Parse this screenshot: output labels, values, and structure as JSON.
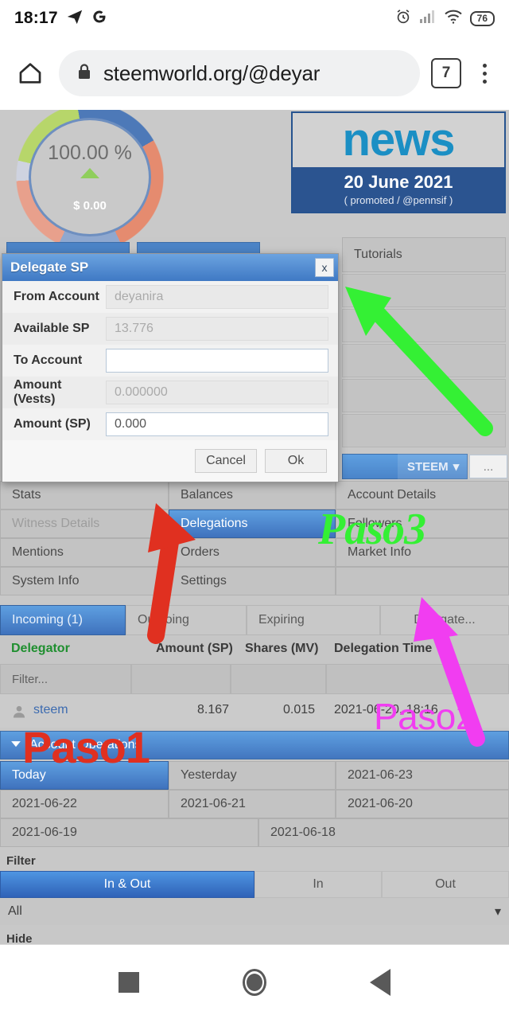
{
  "status_bar": {
    "time": "18:17",
    "icons": [
      "telegram-icon",
      "google-icon",
      "alarm-icon",
      "signal-icon",
      "wifi-icon"
    ],
    "battery": "76"
  },
  "browser": {
    "home_icon": "home-icon",
    "lock_icon": "lock-icon",
    "url": "steemworld.org/@deyar",
    "tab_count": "7",
    "menu_icon": "kebab-menu-icon"
  },
  "hero": {
    "gauge_percent": "100.00 %",
    "gauge_amount": "$ 0.00",
    "news_word": "news",
    "news_date": "20 June 2021",
    "news_sub": "( promoted / @pennsif )",
    "tutorials_label": "Tutorials"
  },
  "dialog": {
    "title": "Delegate SP",
    "close_label": "x",
    "fields": [
      {
        "label": "From Account",
        "value": "deyanira",
        "editable": false
      },
      {
        "label": "Available SP",
        "value": "13.776",
        "editable": false
      },
      {
        "label": "To Account",
        "value": "",
        "editable": true
      },
      {
        "label": "Amount (Vests)",
        "value": "0.000000",
        "editable": false
      },
      {
        "label": "Amount (SP)",
        "value": "0.000",
        "editable": true
      }
    ],
    "cancel_label": "Cancel",
    "ok_label": "Ok"
  },
  "steem_bar": {
    "currency": "STEEM",
    "caret": "▾",
    "more_label": "..."
  },
  "menu_grid": {
    "rows": [
      [
        {
          "label": "Stats",
          "state": "normal"
        },
        {
          "label": "Balances",
          "state": "normal"
        },
        {
          "label": "Account Details",
          "state": "normal"
        }
      ],
      [
        {
          "label": "Witness Details",
          "state": "disabled"
        },
        {
          "label": "Delegations",
          "state": "selected"
        },
        {
          "label": "Followers",
          "state": "normal"
        }
      ],
      [
        {
          "label": "Mentions",
          "state": "normal"
        },
        {
          "label": "Orders",
          "state": "normal"
        },
        {
          "label": "Market Info",
          "state": "normal"
        }
      ],
      [
        {
          "label": "System Info",
          "state": "normal"
        },
        {
          "label": "Settings",
          "state": "normal"
        },
        {
          "label": "",
          "state": "empty"
        }
      ]
    ]
  },
  "delegations": {
    "tabs": [
      {
        "label": "Incoming (1)",
        "selected": true
      },
      {
        "label": "Outgoing",
        "selected": false
      },
      {
        "label": "Expiring",
        "selected": false
      },
      {
        "label": "Delegate...",
        "selected": false
      }
    ],
    "columns": [
      "Delegator",
      "Amount (SP)",
      "Shares (MV)",
      "Delegation Time"
    ],
    "filter_placeholder": "Filter...",
    "rows": [
      {
        "delegator": "steem",
        "avatar_icon": "user-avatar-icon",
        "amount_sp": "8.167",
        "shares_mv": "0.015",
        "delegation_time": "2021-06-20, 18:16"
      }
    ]
  },
  "account_operations": {
    "caption": "Account Operations",
    "collapse_icon": "caret-down-icon",
    "date_rows": [
      [
        {
          "label": "Today",
          "selected": true
        },
        {
          "label": "Yesterday",
          "selected": false
        },
        {
          "label": "2021-06-23",
          "selected": false
        }
      ],
      [
        {
          "label": "2021-06-22",
          "selected": false
        },
        {
          "label": "2021-06-21",
          "selected": false
        },
        {
          "label": "2021-06-20",
          "selected": false
        }
      ],
      [
        {
          "label": "2021-06-19",
          "selected": false
        },
        {
          "label": "2021-06-18",
          "selected": false
        }
      ]
    ]
  },
  "filter_block": {
    "filter_label": "Filter",
    "in_out": [
      {
        "label": "In & Out",
        "selected": true
      },
      {
        "label": "In",
        "selected": false
      },
      {
        "label": "Out",
        "selected": false
      }
    ],
    "all_value": "All",
    "all_caret": "▾",
    "hide_label": "Hide"
  },
  "annotations": [
    {
      "text": "Paso1",
      "color": "#e03020"
    },
    {
      "text": "Paso2",
      "color": "#f13df1"
    },
    {
      "text": "Paso3",
      "color": "#34f034"
    }
  ],
  "nav_bar": {
    "recents_icon": "square-recents-icon",
    "home_icon": "circle-home-icon",
    "back_icon": "triangle-back-icon"
  }
}
